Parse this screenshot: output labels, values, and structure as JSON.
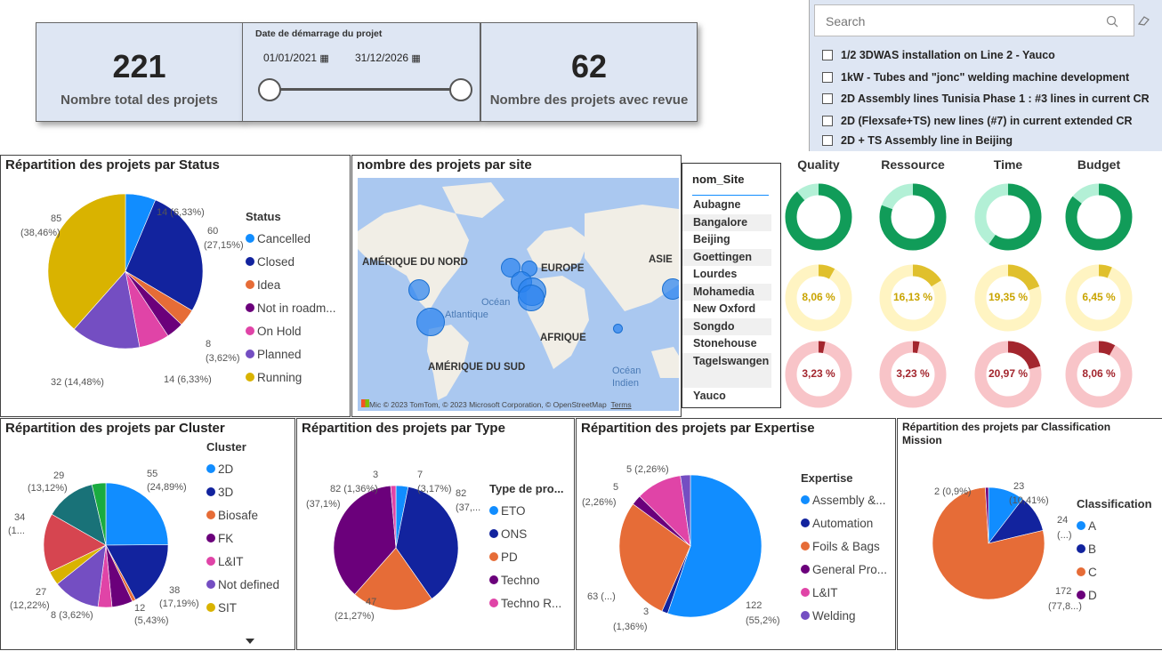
{
  "kpis": {
    "total_projects": {
      "value": "221",
      "label": "Nombre total des projets"
    },
    "reviewed_projects": {
      "value": "62",
      "label": "Nombre des projets avec revue"
    }
  },
  "date_filter": {
    "title": "Date de démarrage du projet",
    "start": "01/01/2021",
    "end": "31/12/2026"
  },
  "search": {
    "placeholder": "Search",
    "items": [
      "1/2 3DWAS installation on Line 2 - Yauco",
      "1kW - Tubes and \"jonc\" welding machine development",
      "2D Assembly lines Tunisia Phase 1 : #3 lines in current CR",
      "2D (Flexsafe+TS) new lines (#7) in current extended CR",
      "2D + TS Assembly line in Beijing"
    ]
  },
  "status_chart": {
    "title": "Répartition des projets par Status",
    "legend_title": "Status",
    "legend": [
      {
        "name": "Cancelled",
        "color": "#118dff"
      },
      {
        "name": "Closed",
        "color": "#12239e"
      },
      {
        "name": "Idea",
        "color": "#e66c37"
      },
      {
        "name": "Not in roadm...",
        "color": "#6b007b"
      },
      {
        "name": "On Hold",
        "color": "#e044a7"
      },
      {
        "name": "Planned",
        "color": "#744ec2"
      },
      {
        "name": "Running",
        "color": "#d9b300"
      }
    ],
    "labels": [
      "14 (6,33%)",
      "60",
      "(27,15%)",
      "8",
      "(3,62%)",
      "14 (6,33%)",
      "32 (14,48%)",
      "85",
      "(38,46%)"
    ]
  },
  "map": {
    "title": "nombre des projets par site",
    "regions": [
      "AMÉRIQUE DU NORD",
      "EUROPE",
      "ASIE",
      "AFRIQUE",
      "AMÉRIQUE DU SUD"
    ],
    "oceans": [
      "Océan",
      "Atlantique",
      "Océan",
      "Indien"
    ],
    "attribution": "© 2023 TomTom, © 2023 Microsoft Corporation, © OpenStreetMap",
    "terms": "Terms",
    "brand": "Mic"
  },
  "sites": {
    "header": "nom_Site",
    "items": [
      "Aubagne",
      "Bangalore",
      "Beijing",
      "Goettingen",
      "Lourdes",
      "Mohamedia",
      "New Oxford",
      "Songdo",
      "Stonehouse",
      "Tagelswangen",
      "Yauco"
    ]
  },
  "gauges": {
    "columns": [
      "Quality",
      "Ressource",
      "Time",
      "Budget"
    ],
    "green": [
      "88,71 %",
      "80,65 %",
      "59,68 %",
      "85,48 %"
    ],
    "yellow": [
      "8,06 %",
      "16,13 %",
      "19,35 %",
      "6,45 %"
    ],
    "red": [
      "3,23 %",
      "3,23 %",
      "20,97 %",
      "8,06 %"
    ],
    "colors": {
      "green": "#119c59",
      "green_bg": "#b3f0d6",
      "yellow": "#e0c02d",
      "yellow_bg": "#fff4c2",
      "red": "#a3262e",
      "red_bg": "#f8c4c8"
    }
  },
  "cluster_chart": {
    "title": "Répartition des projets par Cluster",
    "legend_title": "Cluster",
    "legend": [
      {
        "name": "2D",
        "color": "#118dff"
      },
      {
        "name": "3D",
        "color": "#12239e"
      },
      {
        "name": "Biosafe",
        "color": "#e66c37"
      },
      {
        "name": "FK",
        "color": "#6b007b"
      },
      {
        "name": "L&IT",
        "color": "#e044a7"
      },
      {
        "name": "Not defined",
        "color": "#744ec2"
      },
      {
        "name": "SIT",
        "color": "#d9b300"
      }
    ],
    "labels": [
      "55",
      "(24,89%)",
      "38",
      "(17,19%)",
      "12",
      "(5,43%)",
      "8 (3,62%)",
      "27",
      "(12,22%)",
      "34",
      "(1...",
      "29",
      "(13,12%)"
    ]
  },
  "type_chart": {
    "title": "Répartition des projets par Type",
    "legend_title": "Type de pro...",
    "legend": [
      {
        "name": "ETO",
        "color": "#118dff"
      },
      {
        "name": "ONS",
        "color": "#12239e"
      },
      {
        "name": "PD",
        "color": "#e66c37"
      },
      {
        "name": "Techno",
        "color": "#6b007b"
      },
      {
        "name": "Techno R...",
        "color": "#e044a7"
      }
    ],
    "labels": [
      "3",
      "82 (1,36%)",
      "(37,1%)",
      "7",
      "(3,17%)",
      "82",
      "(37,...",
      "47",
      "(21,27%)"
    ]
  },
  "expertise_chart": {
    "title": "Répartition des projets par Expertise",
    "legend_title": "Expertise",
    "legend": [
      {
        "name": "Assembly &...",
        "color": "#118dff"
      },
      {
        "name": "Automation",
        "color": "#12239e"
      },
      {
        "name": "Foils & Bags",
        "color": "#e66c37"
      },
      {
        "name": "General Pro...",
        "color": "#6b007b"
      },
      {
        "name": "L&IT",
        "color": "#e044a7"
      },
      {
        "name": "Welding",
        "color": "#744ec2"
      }
    ],
    "labels": [
      "5 (2,26%)",
      "5",
      "(2,26%)",
      "63 (...)",
      "3",
      "(1,36%)",
      "122",
      "(55,2%)"
    ]
  },
  "classification_chart": {
    "title": "Répartition des projets par Classification Mission",
    "legend_title": "Classification",
    "legend": [
      {
        "name": "A",
        "color": "#118dff"
      },
      {
        "name": "B",
        "color": "#12239e"
      },
      {
        "name": "C",
        "color": "#e66c37"
      },
      {
        "name": "D",
        "color": "#6b007b"
      }
    ],
    "labels": [
      "2 (0,9%)",
      "23",
      "(10,41%)",
      "24",
      "(...)",
      "172",
      "(77,8...)"
    ]
  },
  "chart_data": [
    {
      "type": "pie",
      "title": "Répartition des projets par Status",
      "categories": [
        "Cancelled",
        "Closed",
        "Idea",
        "Not in roadm...",
        "On Hold",
        "Planned",
        "Running"
      ],
      "values": [
        14,
        60,
        8,
        8,
        14,
        32,
        85
      ]
    },
    {
      "type": "pie",
      "title": "Répartition des projets par Cluster",
      "categories": [
        "2D",
        "3D",
        "Biosafe",
        "FK",
        "L&IT",
        "Not defined",
        "SIT"
      ],
      "values": [
        55,
        38,
        2,
        12,
        8,
        27,
        8,
        34,
        29
      ]
    },
    {
      "type": "pie",
      "title": "Répartition des projets par Type",
      "categories": [
        "ETO",
        "ONS",
        "PD",
        "Techno",
        "Techno R..."
      ],
      "values": [
        7,
        82,
        47,
        82,
        3
      ]
    },
    {
      "type": "pie",
      "title": "Répartition des projets par Expertise",
      "categories": [
        "Assembly &...",
        "Automation",
        "Foils & Bags",
        "General Pro...",
        "L&IT",
        "Welding"
      ],
      "values": [
        122,
        3,
        63,
        5,
        23,
        5
      ]
    },
    {
      "type": "pie",
      "title": "Répartition des projets par Classification Mission",
      "categories": [
        "A",
        "B",
        "C",
        "D"
      ],
      "values": [
        23,
        24,
        172,
        2
      ]
    }
  ]
}
